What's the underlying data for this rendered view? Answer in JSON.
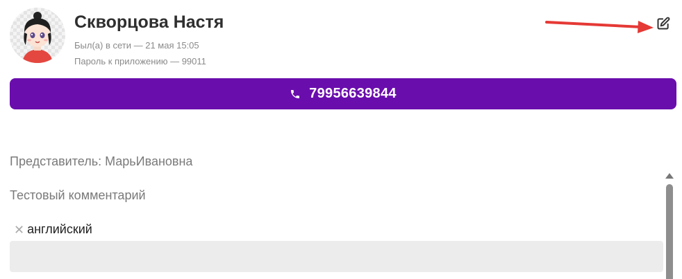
{
  "profile": {
    "name": "Скворцова Настя",
    "last_seen": "Был(а) в сети — 21 мая 15:05",
    "app_password": "Пароль к приложению — 99011"
  },
  "contact": {
    "phone": "79956639844",
    "phone_icon": "phone-icon"
  },
  "details": {
    "representative": "Представитель: МарьИвановна",
    "comment": "Тестовый комментарий"
  },
  "tags": [
    {
      "label": "английский"
    }
  ],
  "icons": {
    "edit": "edit-icon",
    "remove": "close-icon"
  },
  "colors": {
    "accent": "#6a0dad",
    "annotation_arrow": "#e53935"
  }
}
